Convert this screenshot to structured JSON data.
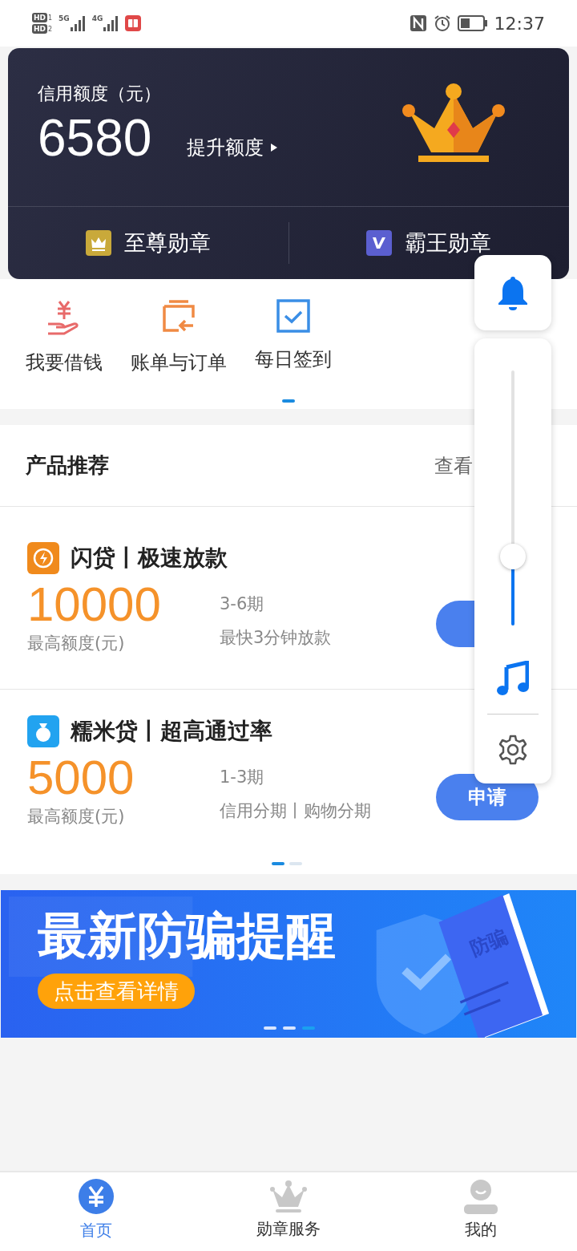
{
  "status_bar": {
    "sims": [
      {
        "badge": "HD",
        "slot": "1"
      },
      {
        "badge": "HD",
        "slot": "2"
      }
    ],
    "networks": [
      "5G",
      "4G"
    ],
    "time": "12:37"
  },
  "credit_card": {
    "label": "信用额度（元）",
    "amount": "6580",
    "raise_link": "提升额度",
    "badges": [
      {
        "label": "至尊勋章",
        "kind": "crown",
        "color": "#c9a93a"
      },
      {
        "label": "霸王勋章",
        "kind": "v",
        "color": "#5b5fd0"
      }
    ]
  },
  "quick_menu": [
    {
      "label": "我要借钱",
      "kind": "loan"
    },
    {
      "label": "账单与订单",
      "kind": "bill"
    },
    {
      "label": "每日签到",
      "kind": "checkin"
    }
  ],
  "products": {
    "title": "产品推荐",
    "more_link": "查看",
    "items": [
      {
        "kind": "flash",
        "name": "闪贷丨极速放款",
        "amount": "10000",
        "amount_label": "最高额度(元)",
        "term": "3-6期",
        "feature": "最快3分钟放款"
      },
      {
        "kind": "bag",
        "name": "糯米贷丨超高通过率",
        "amount": "5000",
        "amount_label": "最高额度(元)",
        "term": "1-3期",
        "feature": "信用分期丨购物分期",
        "apply": "申请"
      }
    ],
    "dots": [
      {
        "selected": true
      },
      {
        "selected": false
      }
    ]
  },
  "banner": {
    "title": "最新防骗提醒",
    "button": "点击查看详情",
    "book_label": "防骗",
    "dots": [
      {
        "selected": false
      },
      {
        "selected": false
      },
      {
        "selected": true
      }
    ]
  },
  "volume_panel": {
    "level": 0.27
  },
  "tab_bar": [
    {
      "label": "首页",
      "kind": "home",
      "selected": true
    },
    {
      "label": "勋章服务",
      "kind": "medal",
      "selected": false
    },
    {
      "label": "我的",
      "kind": "profile",
      "selected": false
    }
  ]
}
